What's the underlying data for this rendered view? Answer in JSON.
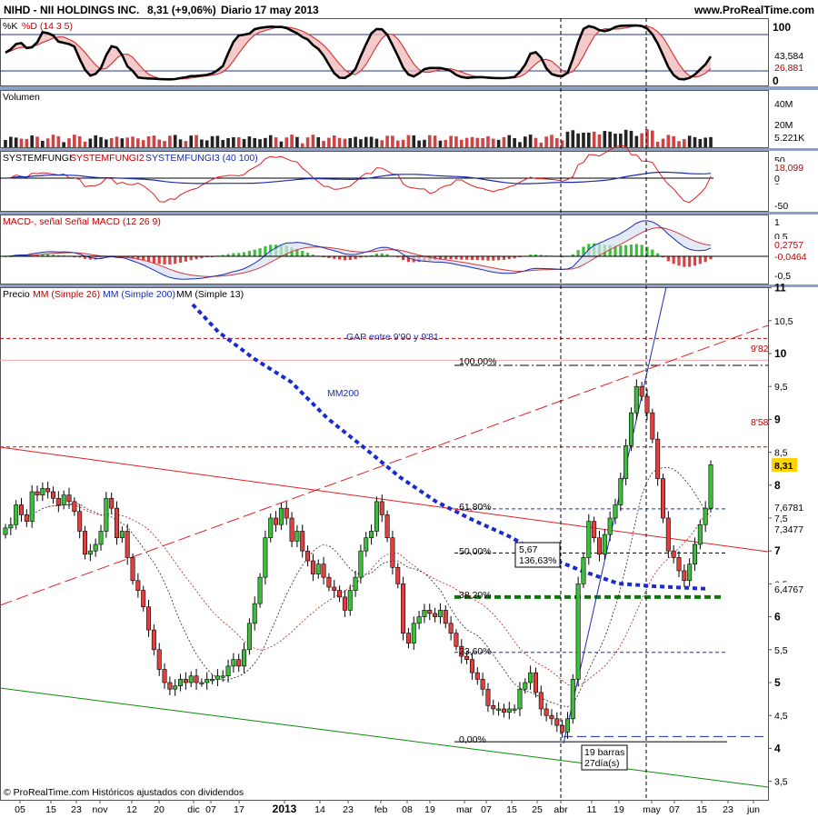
{
  "header": {
    "symbol": "NIHD - NII HOLDINGS INC.",
    "price": "8,31 (+9,06%)",
    "period": "Diario",
    "date": "17 may 2013",
    "site": "www.ProRealTime.com"
  },
  "panels": {
    "stoch": {
      "title_k": "%K",
      "title_d": "%D (14 3 5)",
      "ticks": [
        "100",
        "0"
      ],
      "val1": "43,584",
      "val2": "26,881"
    },
    "volume": {
      "title": "Volumen",
      "ticks": [
        "40M",
        "20M"
      ],
      "val": "5.221K"
    },
    "systemfungi": {
      "t1": "SYSTEMFUNGI",
      "t2": "SYSTEMFUNGI2",
      "t3": "SYSTEMFUNGI3 (40 100)",
      "ticks": [
        "50",
        "0",
        "-50"
      ],
      "val1": "18,099",
      "val2": "0"
    },
    "macd": {
      "t1": "MACD-, señal Señal MACD (12 26 9)",
      "ticks": [
        "1",
        "0,5",
        "0",
        "-0,5"
      ],
      "val1": "0,2757",
      "val2": "-0,0464"
    },
    "price": {
      "title_a": "Precio",
      "title_b": "MM (Simple 26)",
      "title_c": "MM (Simple 200)",
      "title_d": "MM (Simple 13)",
      "ticks": [
        "11",
        "10,5",
        "10",
        "9,5",
        "9",
        "8,5",
        "8",
        "7,5",
        "7",
        "6,5",
        "6",
        "5,5",
        "5",
        "4,5",
        "4",
        "3,5"
      ],
      "last_price": "8,31",
      "val_mm13": "7,6781",
      "val_mm26": "7,3477",
      "val_mm200": "6,4767",
      "gap_label": "GAP entre 9'90 y 9'81",
      "label_982": "9'82",
      "label_858": "8'58",
      "mm200_label": "MM200",
      "fib": [
        "100,00%",
        "61,80%",
        "50,00%",
        "38,20%",
        "23,60%",
        "0,00%"
      ],
      "box1": [
        "5,67",
        "136,63%"
      ],
      "box2": [
        "19 barras",
        "27día(s)"
      ],
      "footer": "© ProRealTime.com Históricos ajustados con dividendos"
    }
  },
  "xaxis": [
    {
      "t": "05",
      "b": false
    },
    {
      "t": "15",
      "b": false
    },
    {
      "t": "23",
      "b": false
    },
    {
      "t": "nov",
      "b": false
    },
    {
      "t": "12",
      "b": false
    },
    {
      "t": "20",
      "b": false
    },
    {
      "t": "dic",
      "b": false
    },
    {
      "t": "07",
      "b": false
    },
    {
      "t": "17",
      "b": false
    },
    {
      "t": "2013",
      "b": true
    },
    {
      "t": "14",
      "b": false
    },
    {
      "t": "23",
      "b": false
    },
    {
      "t": "feb",
      "b": false
    },
    {
      "t": "08",
      "b": false
    },
    {
      "t": "19",
      "b": false
    },
    {
      "t": "mar",
      "b": false
    },
    {
      "t": "07",
      "b": false
    },
    {
      "t": "15",
      "b": false
    },
    {
      "t": "25",
      "b": false
    },
    {
      "t": "abr",
      "b": false
    },
    {
      "t": "11",
      "b": false
    },
    {
      "t": "19",
      "b": false
    },
    {
      "t": "may",
      "b": false
    },
    {
      "t": "07",
      "b": false
    },
    {
      "t": "15",
      "b": false
    },
    {
      "t": "23",
      "b": false
    },
    {
      "t": "jun",
      "b": false
    }
  ],
  "chart_data": {
    "type": "candlestick",
    "title": "NIHD - NII HOLDINGS INC. 8,31 (+9,06%) Diario 17 may 2013",
    "ylim": [
      3.5,
      11
    ],
    "close": [
      7.35,
      7.4,
      7.7,
      7.55,
      7.45,
      7.9,
      7.85,
      7.95,
      7.9,
      7.8,
      7.7,
      7.85,
      7.75,
      7.6,
      7.3,
      6.95,
      7.0,
      7.1,
      7.3,
      7.8,
      7.65,
      7.2,
      7.3,
      6.9,
      6.55,
      6.4,
      6.15,
      5.8,
      5.5,
      5.2,
      5.0,
      4.9,
      4.95,
      5.05,
      5.0,
      5.1,
      5.0,
      5.0,
      5.05,
      5.05,
      5.1,
      5.1,
      5.25,
      5.35,
      5.25,
      5.5,
      5.9,
      6.2,
      6.6,
      7.2,
      7.5,
      7.4,
      7.65,
      7.5,
      7.15,
      7.3,
      7.0,
      6.85,
      6.65,
      6.8,
      6.6,
      6.45,
      6.4,
      6.3,
      6.1,
      6.4,
      6.6,
      7.0,
      7.2,
      7.3,
      7.75,
      7.55,
      7.2,
      6.75,
      6.5,
      5.75,
      5.6,
      5.9,
      6.0,
      6.1,
      6.05,
      6.0,
      6.1,
      5.9,
      5.75,
      5.55,
      5.4,
      5.35,
      5.15,
      5.05,
      4.9,
      4.65,
      4.6,
      4.6,
      4.55,
      4.6,
      4.6,
      4.9,
      5.0,
      5.15,
      4.85,
      4.6,
      4.5,
      4.45,
      4.35,
      4.25,
      4.45,
      5.05,
      6.5,
      6.9,
      7.45,
      7.2,
      6.95,
      7.25,
      7.5,
      7.7,
      8.1,
      8.6,
      9.1,
      9.5,
      9.35,
      9.1,
      8.7,
      8.1,
      7.5,
      7.0,
      6.9,
      6.7,
      6.55,
      6.8,
      7.1,
      7.4,
      7.65,
      8.31
    ],
    "mm13_last": 7.6781,
    "mm26_last": 7.3477,
    "mm200_last": 6.4767,
    "gap": [
      9.81,
      9.9
    ],
    "levels": [
      9.82,
      8.58
    ],
    "fibonacci": {
      "0%": 4.1,
      "23.6%": 5.46,
      "38.2%": 6.3,
      "50%": 6.97,
      "61.8%": 7.64,
      "100%": 9.82
    },
    "volume_last": "5.221K",
    "stoch_last": [
      43.584,
      26.881
    ],
    "systemfungi_last": [
      18.099,
      0
    ],
    "macd_last": [
      0.2757,
      -0.0464
    ],
    "x_ticks": [
      "05",
      "15",
      "23",
      "nov",
      "12",
      "20",
      "dic",
      "07",
      "17",
      "2013",
      "14",
      "23",
      "feb",
      "08",
      "19",
      "mar",
      "07",
      "15",
      "25",
      "abr",
      "11",
      "19",
      "may",
      "07",
      "15",
      "23",
      "jun"
    ]
  }
}
